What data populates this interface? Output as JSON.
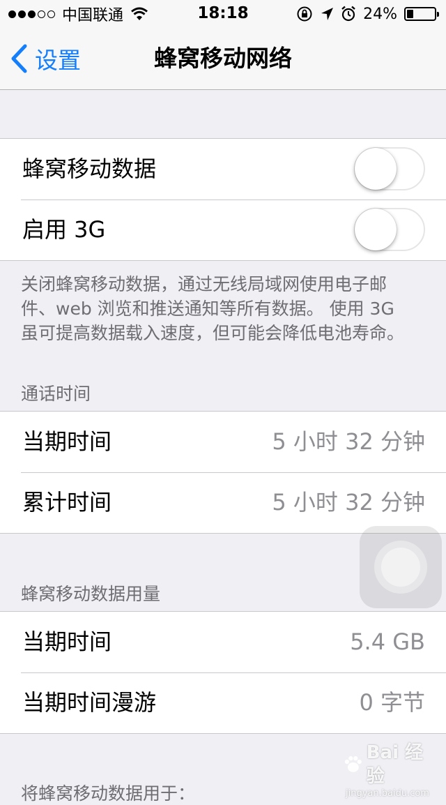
{
  "status_bar": {
    "carrier": "中国联通",
    "signal_filled": 3,
    "signal_total": 5,
    "time": "18:18",
    "battery_text": "24%",
    "battery_level": 0.24,
    "icons": [
      "wifi-icon",
      "rotation-lock-icon",
      "location-arrow-icon",
      "alarm-icon",
      "battery-icon"
    ]
  },
  "nav": {
    "back_label": "设置",
    "title": "蜂窝移动网络",
    "accent_color": "#147efb"
  },
  "cellular": {
    "rows": [
      {
        "label": "蜂窝移动数据",
        "on": false
      },
      {
        "label": "启用 3G",
        "on": false
      }
    ],
    "footnote_lines": [
      "关闭蜂窝移动数据，通过无线局域网使用电子邮",
      "件、web 浏览和推送通知等所有数据。 使用 3G",
      "虽可提高数据载入速度，但可能会降低电池寿命。"
    ]
  },
  "call_time": {
    "header": "通话时间",
    "rows": [
      {
        "label": "当期时间",
        "value": "5 小时 32 分钟"
      },
      {
        "label": "累计时间",
        "value": "5 小时 32 分钟"
      }
    ]
  },
  "data_usage": {
    "header": "蜂窝移动数据用量",
    "rows": [
      {
        "label": "当期时间",
        "value": "5.4 GB"
      },
      {
        "label": "当期时间漫游",
        "value": "0 字节"
      }
    ]
  },
  "use_data_for_header": "将蜂窝移动数据用于：",
  "watermark": {
    "brand": "Bai 经验",
    "url": "jingyan.baidu.com"
  }
}
